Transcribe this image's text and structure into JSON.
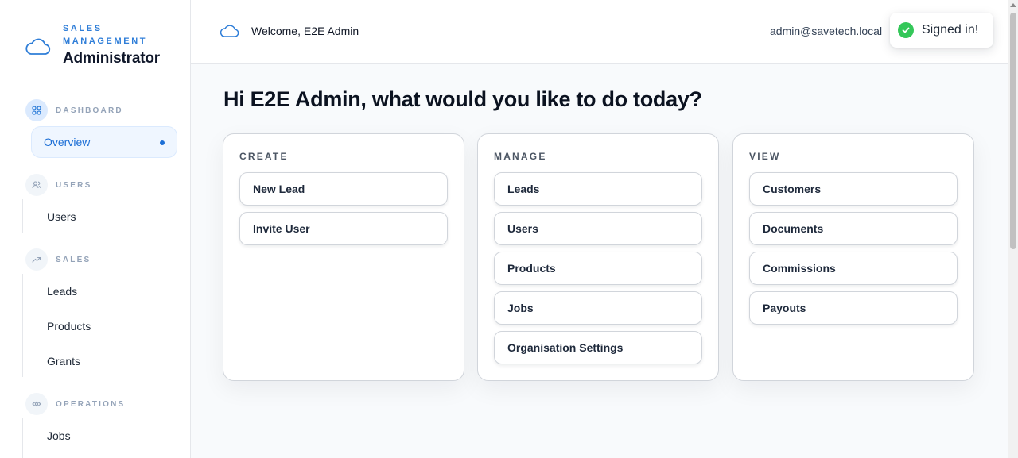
{
  "brand": {
    "kicker": "SALES MANAGEMENT",
    "title": "Administrator",
    "logo_icon": "cloud-icon"
  },
  "sidebar": {
    "sections": [
      {
        "label": "DASHBOARD",
        "icon": "grid-icon",
        "items": [
          "Overview"
        ]
      },
      {
        "label": "USERS",
        "icon": "users-icon",
        "items": [
          "Users"
        ]
      },
      {
        "label": "SALES",
        "icon": "trend-up-icon",
        "items": [
          "Leads",
          "Products",
          "Grants"
        ]
      },
      {
        "label": "OPERATIONS",
        "icon": "eye-icon",
        "items": [
          "Jobs"
        ]
      }
    ],
    "active_item": "Overview"
  },
  "header": {
    "welcome": "Welcome, E2E Admin",
    "email": "admin@savetech.local"
  },
  "toast": {
    "message": "Signed in!",
    "status_color": "#34c759"
  },
  "main": {
    "greeting": "Hi E2E Admin, what would you like to do today?",
    "cards": [
      {
        "title": "CREATE",
        "actions": [
          "New Lead",
          "Invite User"
        ]
      },
      {
        "title": "MANAGE",
        "actions": [
          "Leads",
          "Users",
          "Products",
          "Jobs",
          "Organisation Settings"
        ]
      },
      {
        "title": "VIEW",
        "actions": [
          "Customers",
          "Documents",
          "Commissions",
          "Payouts"
        ]
      }
    ]
  },
  "colors": {
    "accent": "#1d6fd6",
    "brand_blue": "#2f7ed8"
  }
}
